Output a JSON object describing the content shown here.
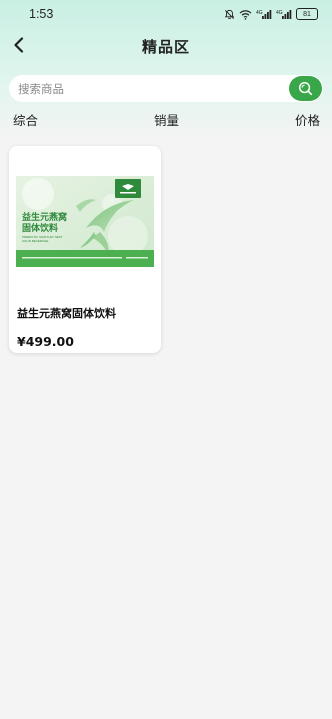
{
  "status_bar": {
    "time": "1:53",
    "battery": "81"
  },
  "nav": {
    "title": "精品区"
  },
  "search": {
    "placeholder": "搜索商品",
    "value": ""
  },
  "sort": {
    "comprehensive": "综合",
    "sales": "销量",
    "price": "价格"
  },
  "products": [
    {
      "name": "益生元燕窝固体饮料",
      "price": "¥499.00",
      "package_title_line1": "益生元燕窝",
      "package_title_line2": "固体饮料",
      "package_en_line1": "PREBIOTIC SWIFTLET NEST",
      "package_en_line2": "SOLID BEVERAGE"
    }
  ],
  "colors": {
    "accent": "#3aa64a",
    "header_top": "#c9efe3",
    "background": "#f4f4f4"
  },
  "icons": {
    "back": "chevron-left-icon",
    "search": "search-icon",
    "mute": "bell-off-icon",
    "wifi": "wifi-icon",
    "signal": "signal-icon",
    "battery": "battery-icon"
  }
}
